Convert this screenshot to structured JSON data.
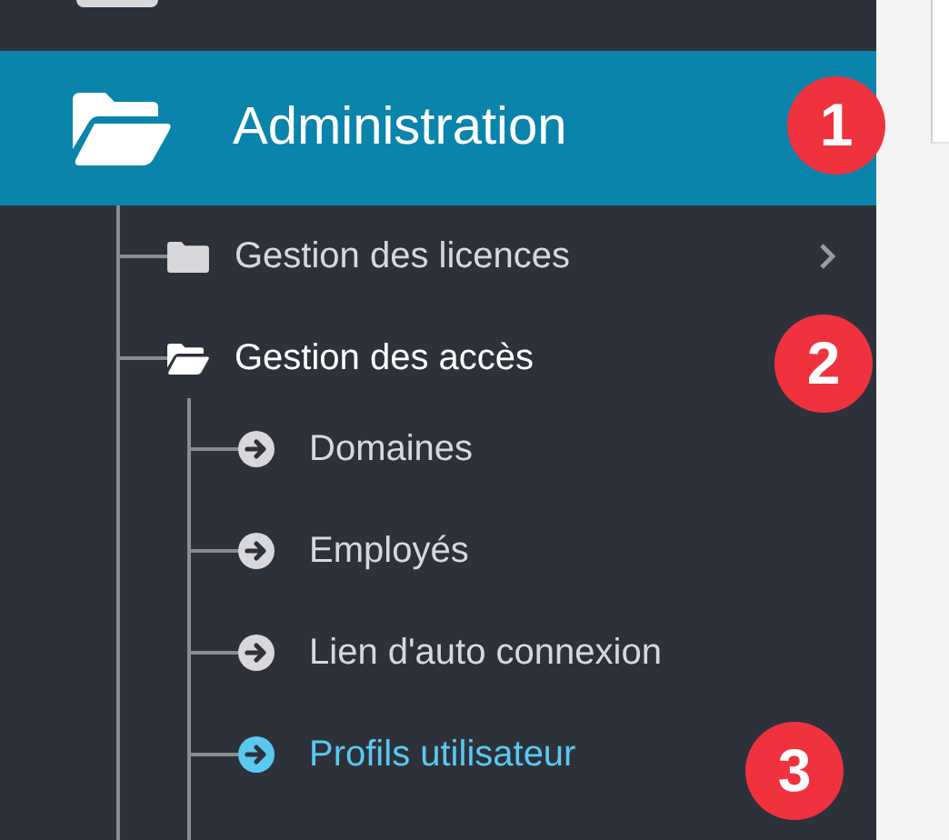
{
  "sidebar": {
    "section": {
      "label": "Administration",
      "selected": true,
      "expanded": true,
      "badge": "1"
    },
    "items": [
      {
        "label": "Gestion des licences",
        "expanded": false
      },
      {
        "label": "Gestion des accès",
        "expanded": true,
        "badge": "2",
        "children": [
          {
            "label": "Domaines",
            "selected": false
          },
          {
            "label": "Employés",
            "selected": false
          },
          {
            "label": "Lien d'auto connexion",
            "selected": false
          },
          {
            "label": "Profils utilisateur",
            "selected": true,
            "badge": "3"
          }
        ]
      }
    ]
  }
}
